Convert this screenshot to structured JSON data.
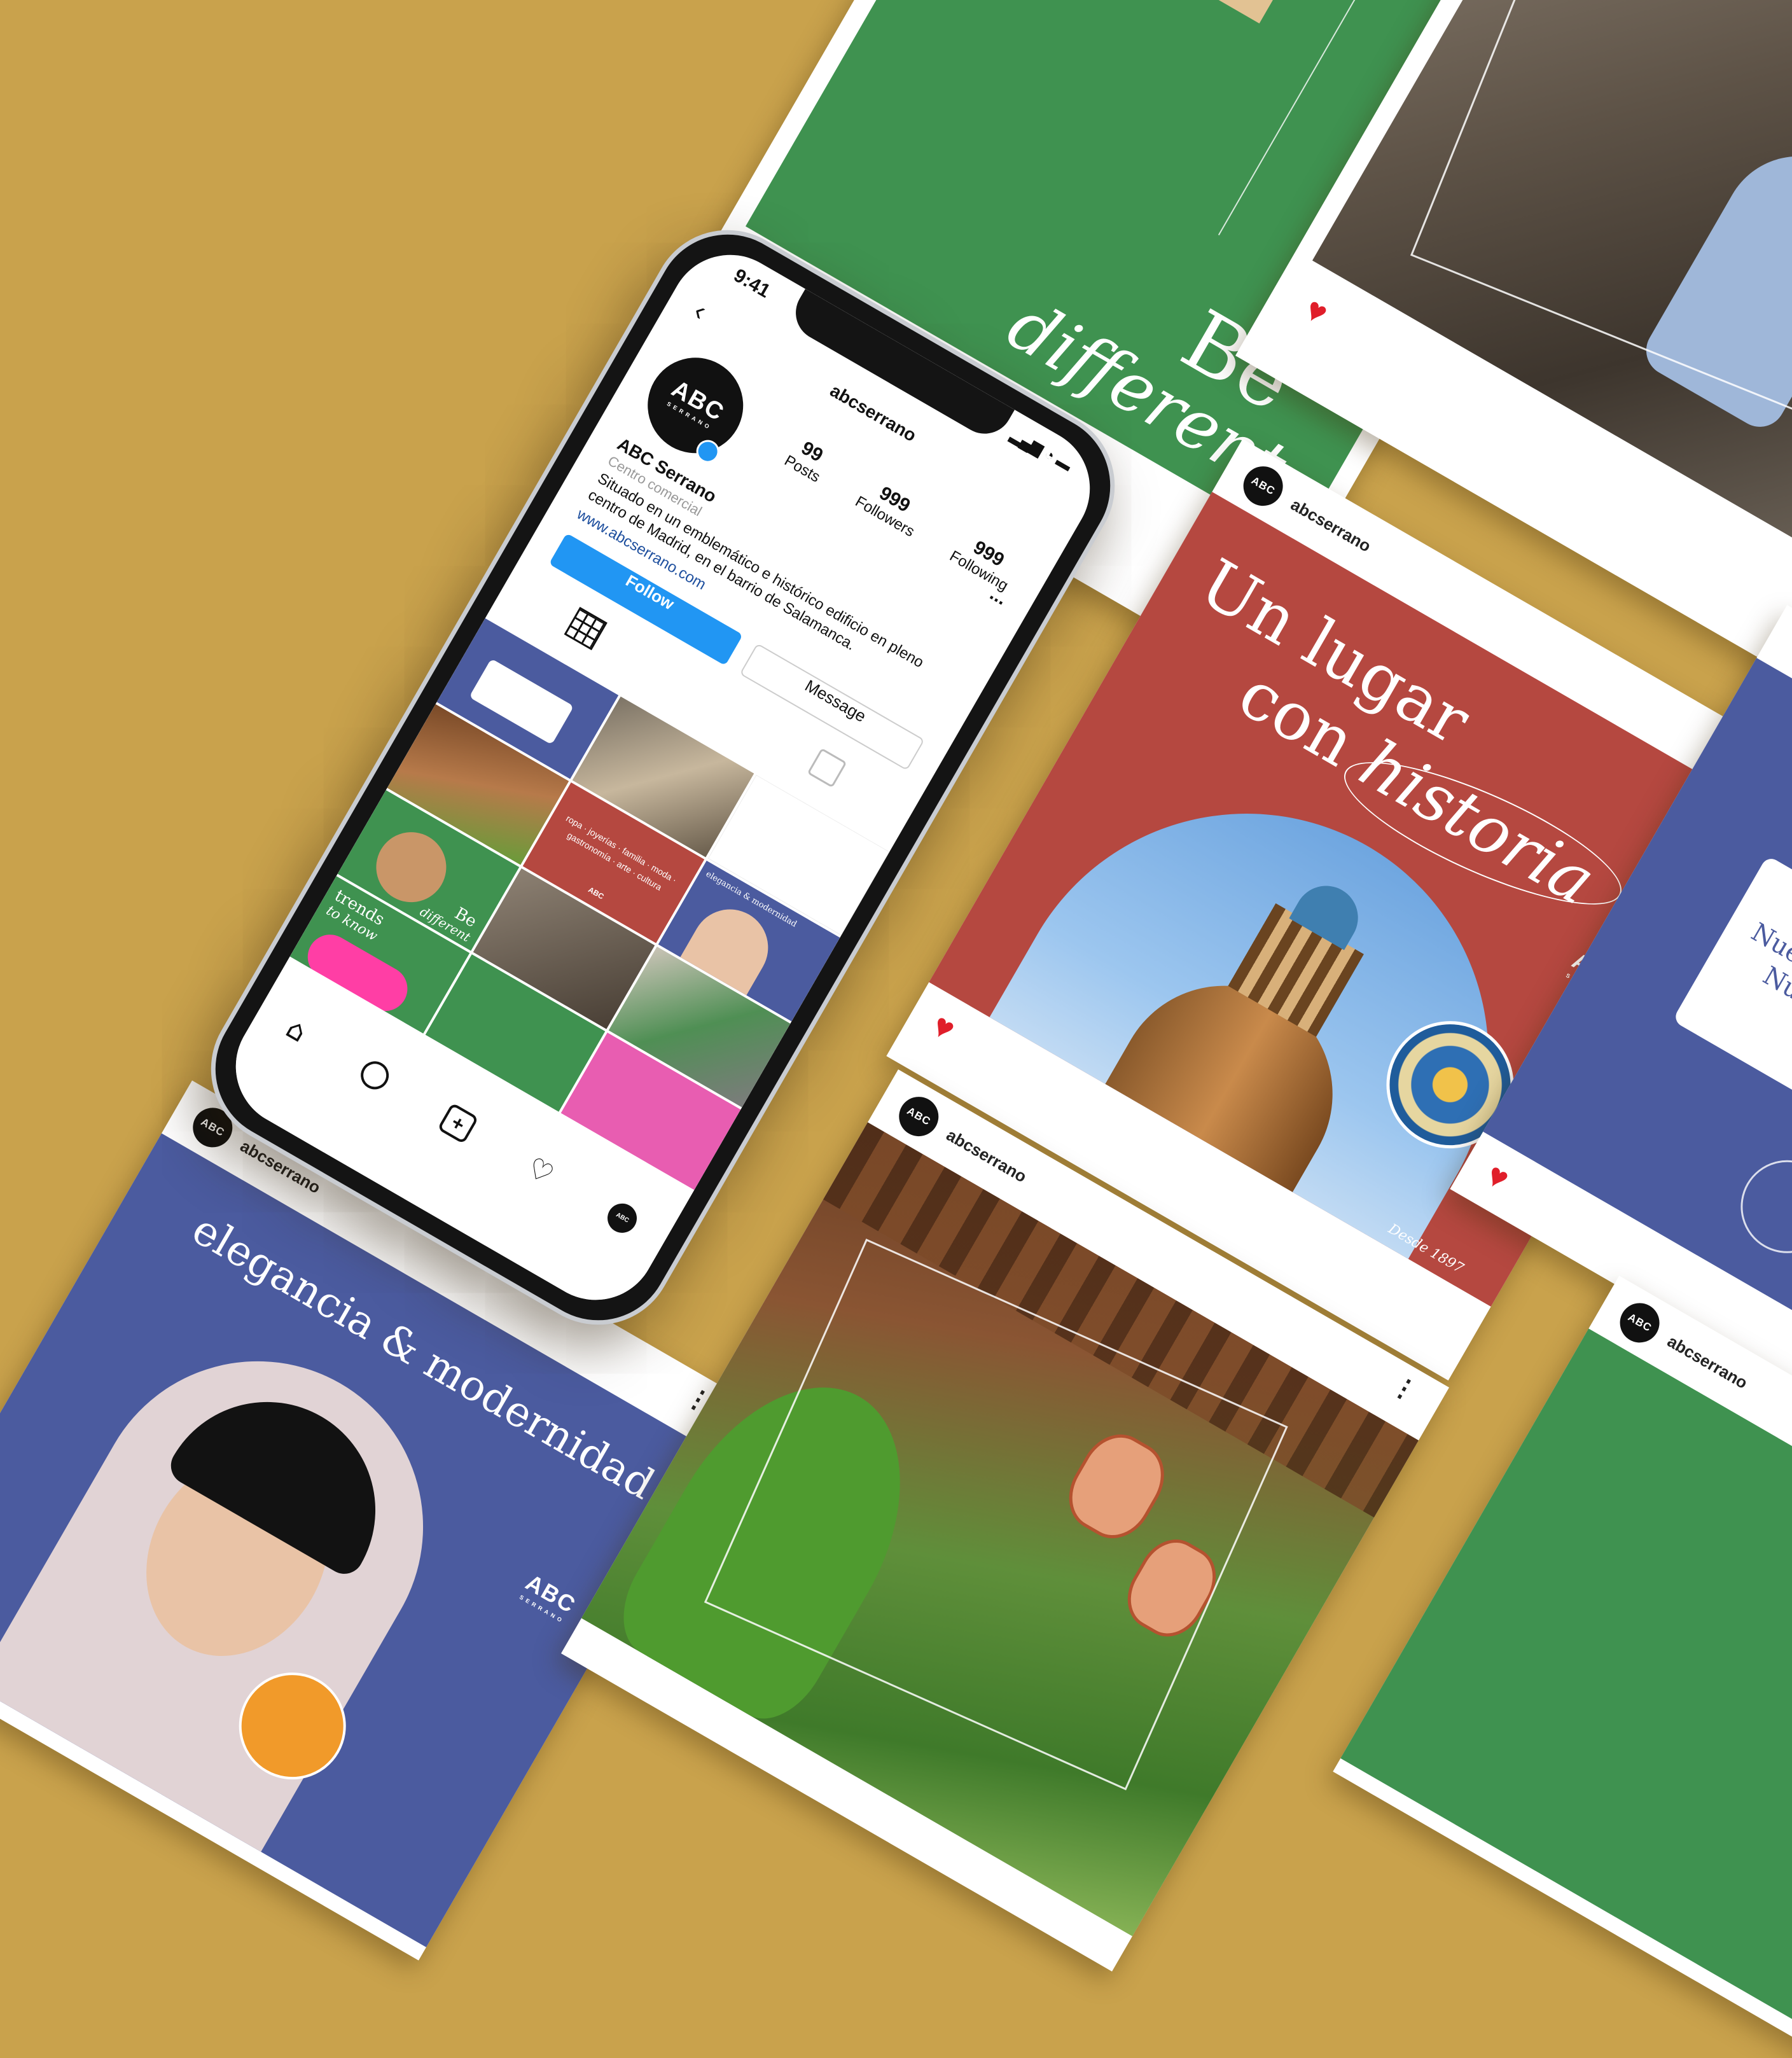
{
  "phone": {
    "time": "9:41",
    "username": "abcserrano",
    "logo": "ABC",
    "logo_sub": "SERRANO",
    "display_name": "ABC Serrano",
    "category": "Centro comercial",
    "bio": "Situado en un emblemático e histórico edificio en pleno centro de Madrid, en el barrio de Salamanca.",
    "website": "www.abcserrano.com",
    "stats": [
      {
        "value": "99",
        "label": "Posts"
      },
      {
        "value": "999",
        "label": "Followers"
      },
      {
        "value": "999",
        "label": "Following"
      }
    ],
    "follow_label": "Follow",
    "message_label": "Message",
    "more_label": "...",
    "grid_texts": {
      "elegancia": "elegancia & modernidad",
      "be": "Be",
      "different": "different",
      "trends": "trends",
      "to_know": "to know",
      "abc": "ABC",
      "words": "ropa · joyerías · familia · moda · gastronomía · arte · cultura"
    },
    "nav_icons": [
      "home-icon",
      "search-icon",
      "add-post-icon",
      "heart-icon",
      "profile-avatar"
    ]
  },
  "posts": {
    "top_green": {
      "be": "Be",
      "different": "different"
    },
    "red": {
      "username": "abcserrano",
      "line1": "Un lugar",
      "line2": "con",
      "line3": "historia",
      "logo": "ABC",
      "logo_sub": "SERRANO",
      "desde": "Desde 1897"
    },
    "blue_bottom": {
      "username": "abcserrano",
      "title": "elegancia & modernidad",
      "logo": "ABC",
      "logo_sub": "SERRANO"
    },
    "garden": {
      "username": "abcserrano"
    },
    "green_bottom": {
      "username": "abcserrano"
    },
    "blue_right": {
      "card_line1": "Nues",
      "card_line2": "Nu"
    }
  },
  "colors": {
    "background": "#c9a24c",
    "green": "#3f9250",
    "red": "#b54840",
    "blue": "#4b5b9f",
    "heart": "#e01e2a",
    "follow": "#2196f3"
  }
}
